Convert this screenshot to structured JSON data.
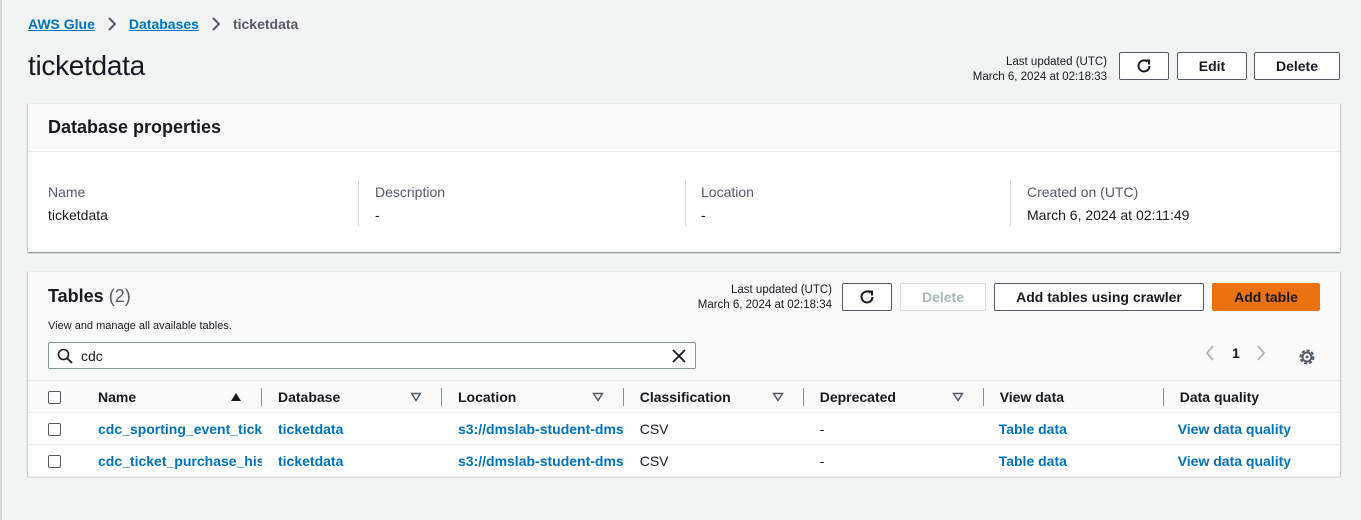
{
  "breadcrumb": {
    "items": [
      "AWS Glue",
      "Databases"
    ],
    "current": "ticketdata"
  },
  "page": {
    "title": "ticketdata",
    "last_updated_label": "Last updated (UTC)",
    "last_updated_value": "March 6, 2024 at 02:18:33",
    "edit_label": "Edit",
    "delete_label": "Delete"
  },
  "properties": {
    "title": "Database properties",
    "fields": [
      {
        "label": "Name",
        "value": "ticketdata"
      },
      {
        "label": "Description",
        "value": "-"
      },
      {
        "label": "Location",
        "value": "-"
      },
      {
        "label": "Created on (UTC)",
        "value": "March 6, 2024 at 02:11:49"
      }
    ]
  },
  "tables": {
    "title": "Tables",
    "count": "(2)",
    "description": "View and manage all available tables.",
    "last_updated_label": "Last updated (UTC)",
    "last_updated_value": "March 6, 2024 at 02:18:34",
    "delete_label": "Delete",
    "crawler_label": "Add tables using crawler",
    "add_label": "Add table",
    "search_value": "cdc",
    "page_number": "1",
    "columns": [
      "Name",
      "Database",
      "Location",
      "Classification",
      "Deprecated",
      "View data",
      "Data quality"
    ],
    "rows": [
      {
        "name": "cdc_sporting_event_ticket",
        "database": "ticketdata",
        "location": "s3://dmslab-student-dms",
        "classification": "CSV",
        "deprecated": "-",
        "view_data": "Table data",
        "data_quality": "View data quality"
      },
      {
        "name": "cdc_ticket_purchase_hist",
        "database": "ticketdata",
        "location": "s3://dmslab-student-dms",
        "classification": "CSV",
        "deprecated": "-",
        "view_data": "Table data",
        "data_quality": "View data quality"
      }
    ]
  },
  "colors": {
    "link": "#0073bb",
    "primary": "#ec7211",
    "background": "#f2f3f3"
  },
  "icons": [
    "chevron-right-icon",
    "refresh-icon",
    "search-icon",
    "clear-icon",
    "chevron-left-icon",
    "settings-icon",
    "sort-ascending-icon",
    "sort-icon"
  ]
}
